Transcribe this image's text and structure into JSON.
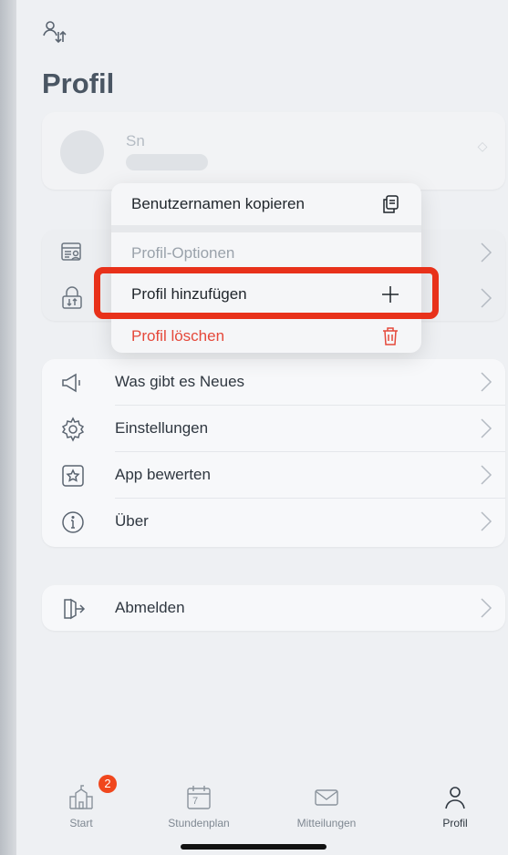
{
  "header": {
    "title": "Profil"
  },
  "profile": {
    "name": "Sn"
  },
  "profile_options": {
    "items": [
      {
        "icon": "id-card-icon"
      },
      {
        "icon": "lock-arrows-icon"
      }
    ]
  },
  "context_menu": {
    "items": [
      {
        "label": "Benutzernamen kopieren",
        "icon": "copy-icon"
      },
      {
        "label": "Profil-Optionen"
      },
      {
        "label": "Profil hinzufügen",
        "icon": "plus-icon"
      },
      {
        "label": "Profil löschen",
        "icon": "trash-icon",
        "color": "#e5483a"
      }
    ]
  },
  "menu": {
    "items": [
      {
        "label": "Was gibt es Neues",
        "icon": "megaphone-icon"
      },
      {
        "label": "Einstellungen",
        "icon": "gear-icon"
      },
      {
        "label": "App bewerten",
        "icon": "star-icon"
      },
      {
        "label": "Über",
        "icon": "info-icon"
      }
    ]
  },
  "logout": {
    "label": "Abmelden",
    "icon": "logout-icon"
  },
  "tabbar": {
    "items": [
      {
        "label": "Start",
        "icon": "school-icon",
        "badge": "2"
      },
      {
        "label": "Stundenplan",
        "icon": "calendar-icon",
        "day": "7"
      },
      {
        "label": "Mitteilungen",
        "icon": "mail-icon"
      },
      {
        "label": "Profil",
        "icon": "person-icon",
        "active": true
      }
    ]
  },
  "colors": {
    "accent_red": "#e8311a",
    "badge": "#f0471d",
    "danger": "#e5483a",
    "title": "#4a5663"
  }
}
